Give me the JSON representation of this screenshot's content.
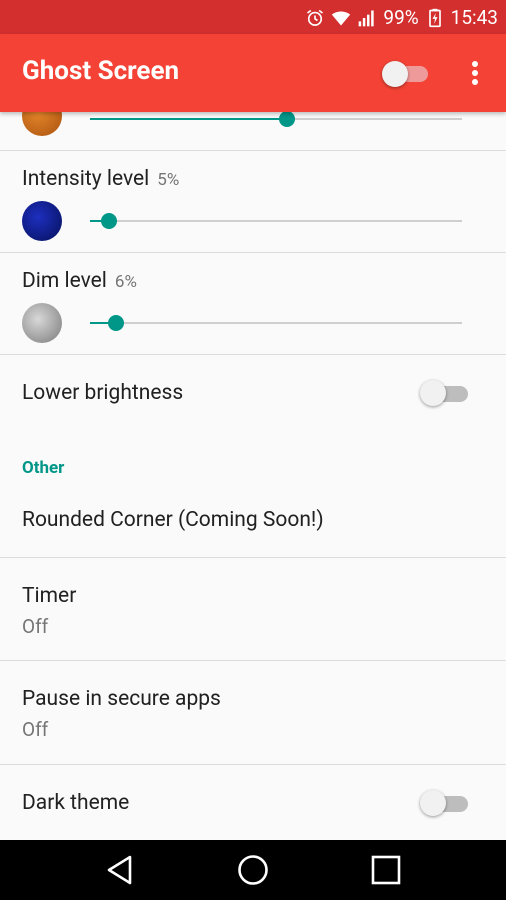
{
  "status_bar": {
    "battery": "99%",
    "time": "15:43",
    "icons": [
      "alarm-icon",
      "wifi-icon",
      "signal-icon",
      "battery-icon"
    ]
  },
  "app_bar": {
    "title": "Ghost Screen",
    "master_toggle": "off",
    "menu_icon": "overflow-menu-icon"
  },
  "settings": {
    "color_level": {
      "icon": "orange-moon-icon",
      "slider_percent": 53
    },
    "intensity": {
      "label": "Intensity level",
      "value": "5%",
      "icon": "blue-moon-icon",
      "slider_percent": 5
    },
    "dim": {
      "label": "Dim level",
      "value": "6%",
      "icon": "grey-moon-icon",
      "slider_percent": 7
    },
    "lower_brightness": {
      "label": "Lower brightness",
      "state": "off"
    },
    "other_section": {
      "title": "Other"
    },
    "rounded_corner": {
      "label": "Rounded Corner (Coming Soon!)"
    },
    "timer": {
      "label": "Timer",
      "summary": "Off"
    },
    "pause_secure": {
      "label": "Pause in secure apps",
      "summary": "Off"
    },
    "dark_theme": {
      "label": "Dark theme",
      "state": "off"
    }
  },
  "nav_bar": {
    "buttons": [
      "back-icon",
      "home-icon",
      "recents-icon"
    ]
  },
  "colors": {
    "status_bar": "#d32f2f",
    "app_bar": "#f44336",
    "accent": "#009688"
  }
}
